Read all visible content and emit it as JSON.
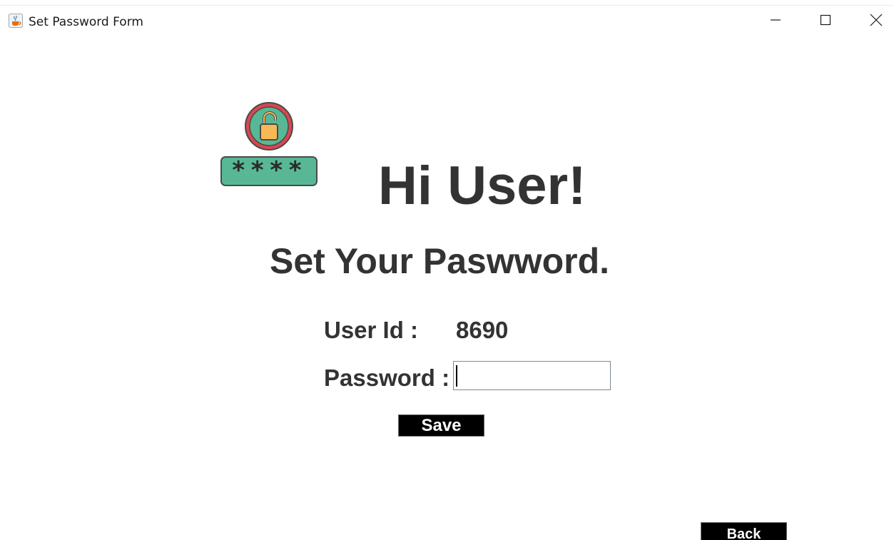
{
  "window": {
    "title": "Set Password Form",
    "icon": "java-cup-icon",
    "controls": {
      "minimize": "minimize-icon",
      "maximize": "maximize-icon",
      "close": "close-icon"
    }
  },
  "header": {
    "greeting": "Hi User!",
    "subheading": "Set Your Paswword.",
    "graphic_icon": "unlocked-padlock-password-icon",
    "graphic_mask": "****"
  },
  "form": {
    "user_id_label": "User Id :",
    "user_id_value": "8690",
    "password_label": "Password :",
    "password_value": "",
    "save_label": "Save"
  },
  "footer": {
    "back_label": "Back"
  },
  "colors": {
    "text": "#333333",
    "button_bg": "#000000",
    "button_text": "#ffffff",
    "lock_ring": "#d9474f",
    "lock_fill": "#58b896",
    "lock_body": "#f7b955"
  }
}
